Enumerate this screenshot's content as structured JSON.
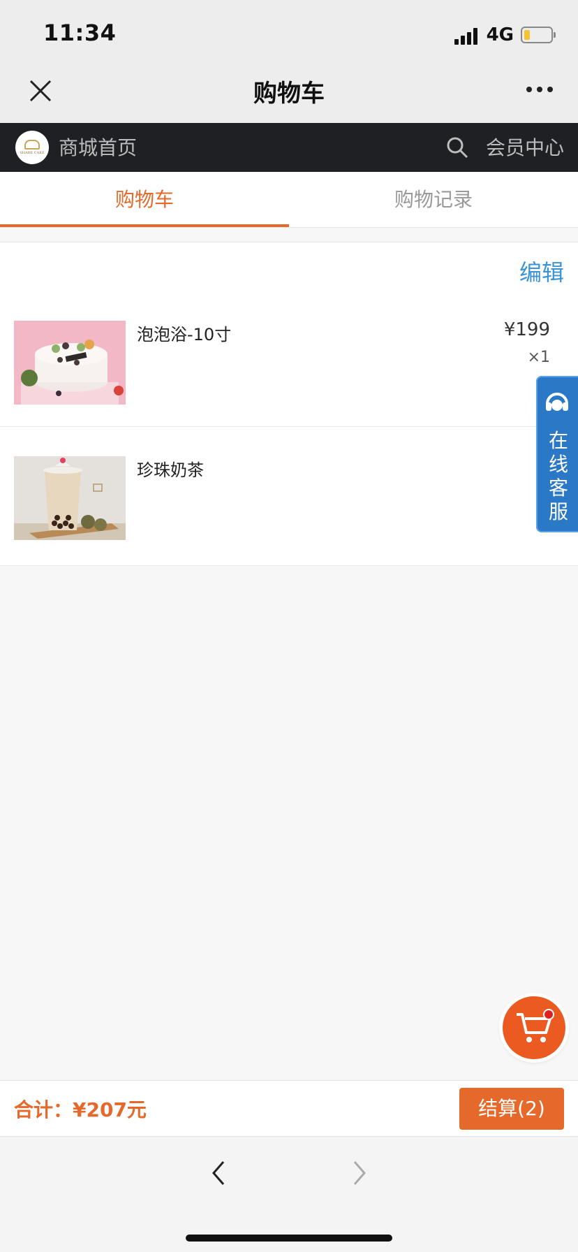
{
  "status": {
    "time": "11:34",
    "network": "4G"
  },
  "nav": {
    "title": "购物车"
  },
  "store_bar": {
    "store_name": "商城首页",
    "member_center": "会员中心",
    "logo_text": "SHARE CAKE"
  },
  "tabs": [
    {
      "label": "购物车",
      "active": true
    },
    {
      "label": "购物记录",
      "active": false
    }
  ],
  "cart": {
    "edit_label": "编辑",
    "items": [
      {
        "name": "泡泡浴-10寸",
        "price": "¥199",
        "qty": "×1"
      },
      {
        "name": "珍珠奶茶",
        "price": "¥",
        "qty": "×"
      }
    ]
  },
  "service": {
    "label": "在线客服"
  },
  "checkout": {
    "total": "合计：¥207元",
    "button": "结算(2)"
  },
  "colors": {
    "accent": "#e4692a",
    "link": "#3a93d6",
    "store_bar_bg": "#1f2023",
    "service_bg": "#2b78c7"
  }
}
